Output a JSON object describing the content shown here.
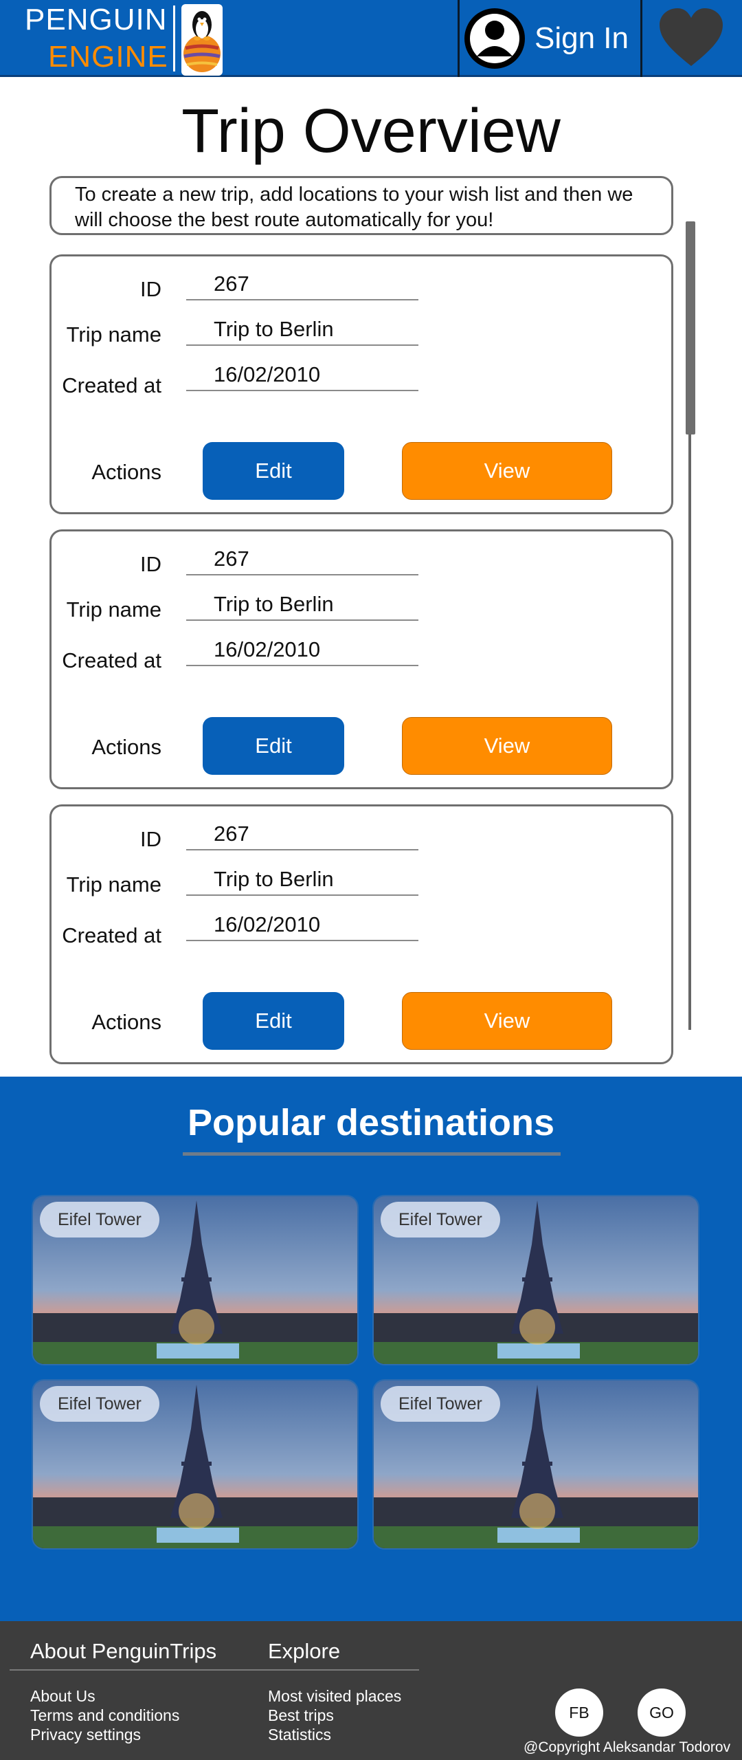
{
  "header": {
    "brand_top": "PENGUIN",
    "brand_bottom": "ENGINE",
    "sign_in_label": "Sign In",
    "colors": {
      "bar": "#0760b8",
      "accent": "#ff8c00"
    }
  },
  "main": {
    "title": "Trip Overview",
    "intro": "To create a new trip, add locations to your wish list and then we will choose the best route automatically for you!",
    "labels": {
      "id": "ID",
      "name": "Trip name",
      "created": "Created at",
      "actions": "Actions"
    },
    "trips": [
      {
        "id": "267",
        "name": "Trip to Berlin",
        "created_at": "16/02/2010",
        "edit_label": "Edit",
        "view_label": "View"
      },
      {
        "id": "267",
        "name": "Trip to Berlin",
        "created_at": "16/02/2010",
        "edit_label": "Edit",
        "view_label": "View"
      },
      {
        "id": "267",
        "name": "Trip to Berlin",
        "created_at": "16/02/2010",
        "edit_label": "Edit",
        "view_label": "View"
      }
    ]
  },
  "popular": {
    "title": "Popular destinations",
    "destinations": [
      {
        "label": "Eifel Tower"
      },
      {
        "label": "Eifel Tower"
      },
      {
        "label": "Eifel Tower"
      },
      {
        "label": "Eifel Tower"
      }
    ]
  },
  "footer": {
    "about_heading": "About PenguinTrips",
    "explore_heading": "Explore",
    "about_links": [
      "About Us",
      "Terms and conditions",
      "Privacy settings"
    ],
    "explore_links": [
      "Most visited places",
      "Best trips",
      "Statistics"
    ],
    "social": [
      "FB",
      "GO"
    ],
    "copyright": "@Copyright Aleksandar Todorov"
  },
  "icons": {
    "logo": "penguin-on-planet-icon",
    "avatar": "user-avatar-icon",
    "favorites": "heart-icon"
  }
}
